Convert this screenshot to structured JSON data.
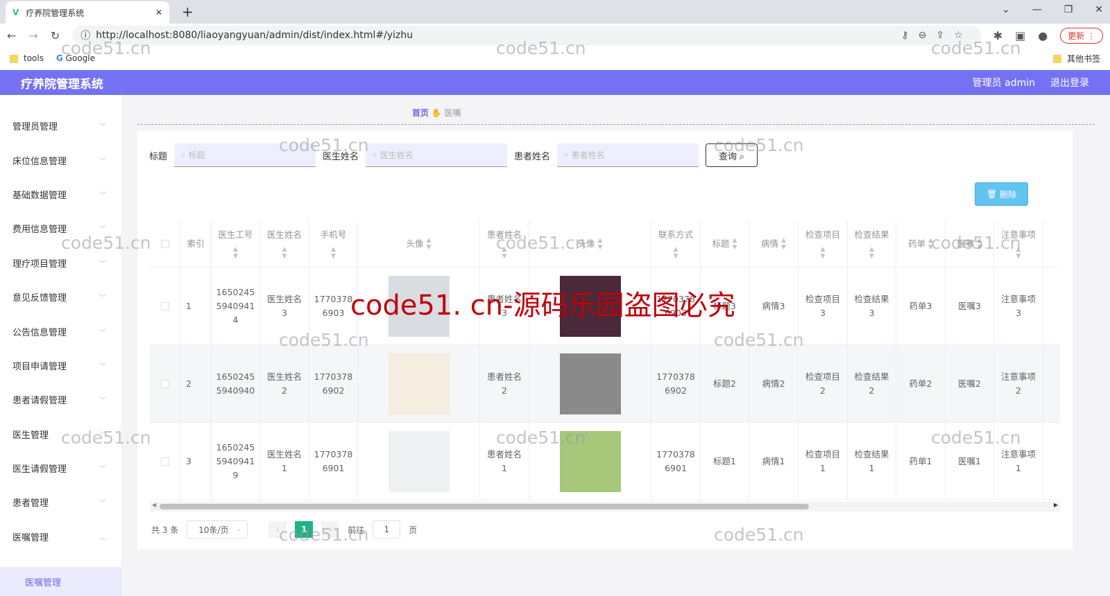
{
  "browser": {
    "tab_title": "疗养院管理系统",
    "url": "http://localhost:8080/liaoyangyuan/admin/dist/index.html#/yizhu",
    "update_label": "更新",
    "bookmarks": [
      "tools",
      "Google"
    ],
    "other_bookmarks": "其他书签"
  },
  "header": {
    "title": "疗养院管理系统",
    "user": "管理员 admin",
    "logout": "退出登录"
  },
  "sidebar": {
    "items": [
      "管理员管理",
      "床位信息管理",
      "基础数据管理",
      "费用信息管理",
      "理疗项目管理",
      "意见反馈管理",
      "公告信息管理",
      "项目申请管理",
      "患者请假管理",
      "医生管理",
      "医生请假管理",
      "患者管理",
      "医嘱管理"
    ],
    "active_sub": "医嘱管理"
  },
  "breadcrumb": {
    "home": "首页",
    "current": "医嘱"
  },
  "search": {
    "fields": [
      {
        "label": "标题",
        "placeholder": "标题"
      },
      {
        "label": "医生姓名",
        "placeholder": "医生姓名"
      },
      {
        "label": "患者姓名",
        "placeholder": "患者姓名"
      }
    ],
    "query_button": "查询",
    "delete_button": "删除"
  },
  "table": {
    "columns": [
      "索引",
      "医生工号",
      "医生姓名",
      "手机号",
      "头像",
      "患者姓名",
      "头像",
      "联系方式",
      "标题",
      "病情",
      "检查项目",
      "检查结果",
      "药单",
      "医嘱",
      "注意事项"
    ],
    "rows": [
      [
        "1",
        "16502455940941 4",
        "医生姓名3",
        "17703786903",
        "",
        "患者姓名3",
        "",
        "17703786903",
        "标题3",
        "病情3",
        "检查项目3",
        "检查结果3",
        "药单3",
        "医嘱3",
        "注意事项3"
      ],
      [
        "2",
        "16502455940940",
        "医生姓名2",
        "17703786902",
        "",
        "患者姓名2",
        "",
        "17703786902",
        "标题2",
        "病情2",
        "检查项目2",
        "检查结果2",
        "药单2",
        "医嘱2",
        "注意事项2"
      ],
      [
        "3",
        "16502455940941 9",
        "医生姓名1",
        "17703786901",
        "",
        "患者姓名1",
        "",
        "17703786901",
        "标题1",
        "病情1",
        "检查项目1",
        "检查结果1",
        "药单1",
        "医嘱1",
        "注意事项1"
      ]
    ]
  },
  "pagination": {
    "total": "共 3 条",
    "page_size": "10条/页",
    "current_page": "1",
    "goto_label": "前往",
    "goto_value": "1",
    "page_unit": "页"
  },
  "watermark": {
    "small": "code51.cn",
    "big": "code51. cn-源码乐园盗图必究"
  }
}
